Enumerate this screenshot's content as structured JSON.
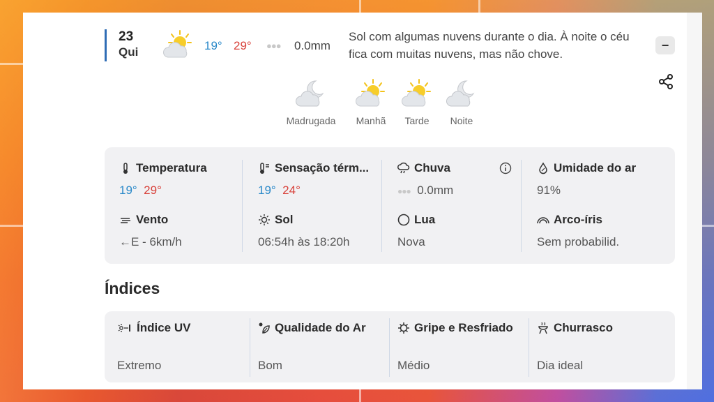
{
  "day": {
    "number": "23",
    "name": "Qui"
  },
  "summary_row": {
    "temp_min": "19°",
    "temp_max": "29°",
    "rain": "0.0mm",
    "description": "Sol com algumas nuvens durante o dia. À noite o céu fica com muitas nuvens, mas não chove."
  },
  "periods": [
    {
      "label": "Madrugada",
      "icon": "moon-cloud-icon"
    },
    {
      "label": "Manhã",
      "icon": "sun-cloud-icon"
    },
    {
      "label": "Tarde",
      "icon": "sun-cloud-icon"
    },
    {
      "label": "Noite",
      "icon": "moon-cloud-icon"
    }
  ],
  "details": {
    "temperatura": {
      "title": "Temperatura",
      "min": "19°",
      "max": "29°"
    },
    "sensacao": {
      "title": "Sensação térm...",
      "min": "19°",
      "max": "24°"
    },
    "chuva": {
      "title": "Chuva",
      "value": "0.0mm"
    },
    "umidade": {
      "title": "Umidade do ar",
      "value": "91%"
    },
    "vento": {
      "title": "Vento",
      "value": "←E - 6km/h"
    },
    "sol": {
      "title": "Sol",
      "value": "06:54h às 18:20h"
    },
    "lua": {
      "title": "Lua",
      "value": "Nova"
    },
    "arco_iris": {
      "title": "Arco-íris",
      "value": "Sem probabilid."
    }
  },
  "indices": {
    "title": "Índices",
    "items": [
      {
        "title": "Índice UV",
        "value": "Extremo",
        "icon": "uv-icon"
      },
      {
        "title": "Qualidade do Ar",
        "value": "Bom",
        "icon": "leaf-icon"
      },
      {
        "title": "Gripe e Resfriado",
        "value": "Médio",
        "icon": "virus-icon"
      },
      {
        "title": "Churrasco",
        "value": "Dia ideal",
        "icon": "grill-icon"
      }
    ]
  },
  "colors": {
    "min_temp": "#2a89c9",
    "max_temp": "#d8413a",
    "accent": "#2f6db5"
  }
}
